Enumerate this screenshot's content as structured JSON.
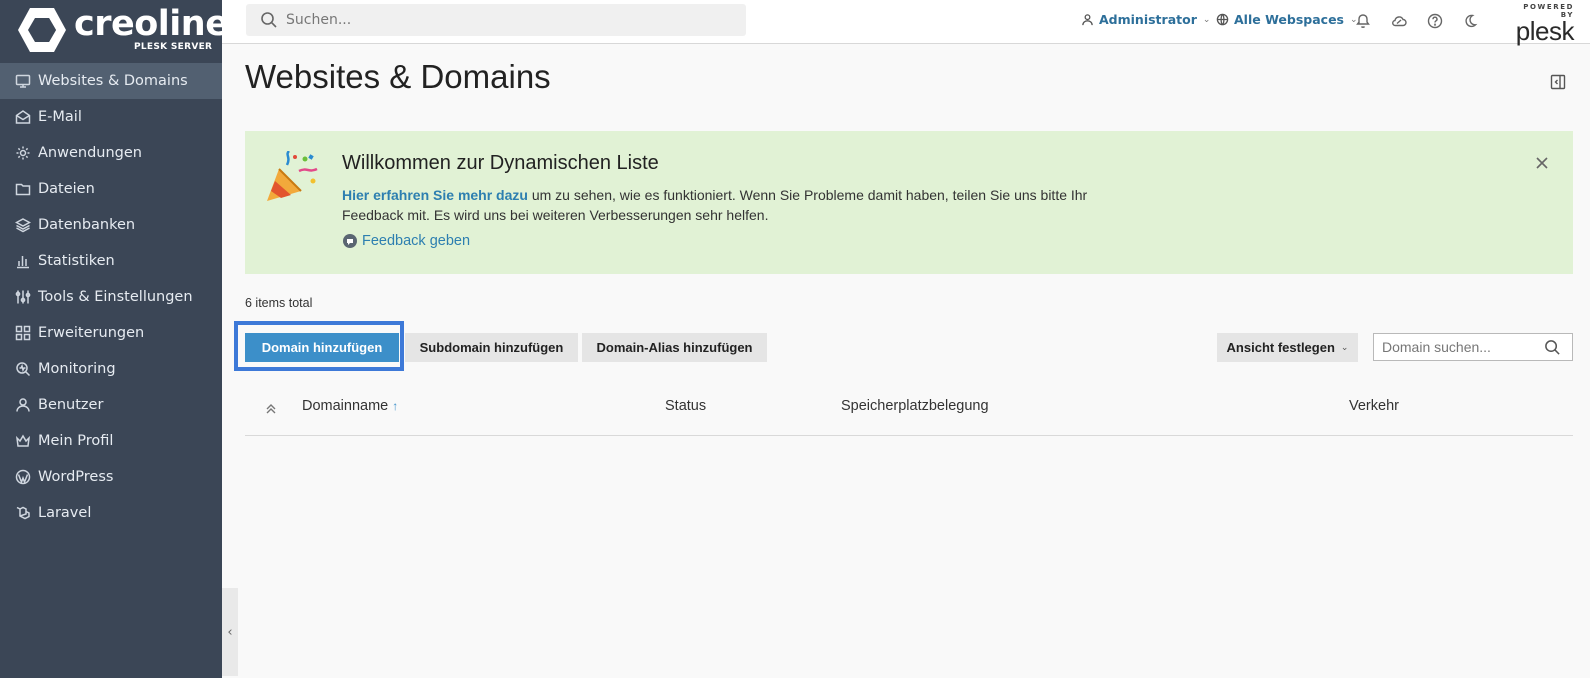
{
  "brand": {
    "name": "creoline",
    "subtitle": "PLESK SERVER"
  },
  "sidebar": {
    "items": [
      {
        "label": "Websites & Domains",
        "icon": "monitor-icon",
        "active": true
      },
      {
        "label": "E-Mail",
        "icon": "mail-icon"
      },
      {
        "label": "Anwendungen",
        "icon": "gear-icon"
      },
      {
        "label": "Dateien",
        "icon": "folder-icon"
      },
      {
        "label": "Datenbanken",
        "icon": "layers-icon"
      },
      {
        "label": "Statistiken",
        "icon": "bar-chart-icon"
      },
      {
        "label": "Tools & Einstellungen",
        "icon": "sliders-icon"
      },
      {
        "label": "Erweiterungen",
        "icon": "grid-icon"
      },
      {
        "label": "Monitoring",
        "icon": "monitoring-search-icon"
      },
      {
        "label": "Benutzer",
        "icon": "user-icon"
      },
      {
        "label": "Mein Profil",
        "icon": "crown-icon"
      },
      {
        "label": "WordPress",
        "icon": "wordpress-icon"
      },
      {
        "label": "Laravel",
        "icon": "laravel-icon"
      }
    ]
  },
  "topbar": {
    "search_placeholder": "Suchen...",
    "user_label": "Administrator",
    "webspace_label": "Alle Webspaces",
    "plesk_small": "POWERED BY",
    "plesk_big": "plesk"
  },
  "page": {
    "title": "Websites & Domains"
  },
  "banner": {
    "title": "Willkommen zur Dynamischen Liste",
    "link_text": "Hier erfahren Sie mehr dazu",
    "text": " um zu sehen, wie es funktioniert. Wenn Sie Probleme damit haben, teilen Sie uns bitte Ihr Feedback mit. Es wird uns bei weiteren Verbesserungen sehr helfen.",
    "feedback_label": "Feedback geben"
  },
  "list": {
    "items_total": "6 items total",
    "add_domain": "Domain hinzufügen",
    "add_subdomain": "Subdomain hinzufügen",
    "add_alias": "Domain-Alias hinzufügen",
    "view_label": "Ansicht festlegen",
    "search_placeholder": "Domain suchen...",
    "columns": [
      "Domainname",
      "Status",
      "Speicherplatzbelegung",
      "Verkehr"
    ]
  },
  "colors": {
    "sidebar_bg": "#3b4656",
    "sidebar_active": "#526071",
    "accent": "#3c8fc9",
    "banner_bg": "#e1f2d5",
    "focus_ring": "#3d79d8"
  }
}
